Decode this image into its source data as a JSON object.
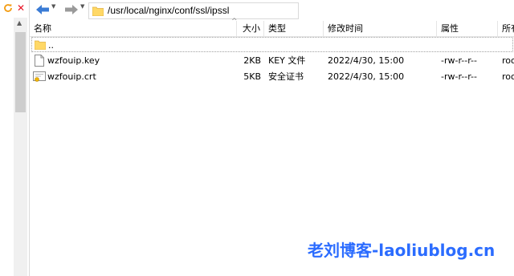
{
  "toolbar": {
    "address_path": "/usr/local/nginx/conf/ssl/ipssl"
  },
  "columns": {
    "name": "名称",
    "size": "大小",
    "type": "类型",
    "modified": "修改时间",
    "attributes": "属性",
    "owner": "所有"
  },
  "files": [
    {
      "name": "..",
      "size": "",
      "type": "",
      "modified": "",
      "attributes": "",
      "owner": "",
      "icon": "folder-icon"
    },
    {
      "name": "wzfouip.key",
      "size": "2KB",
      "type": "KEY 文件",
      "modified": "2022/4/30, 15:00",
      "attributes": "-rw-r--r--",
      "owner": "roo",
      "icon": "file-icon"
    },
    {
      "name": "wzfouip.crt",
      "size": "5KB",
      "type": "安全证书",
      "modified": "2022/4/30, 15:00",
      "attributes": "-rw-r--r--",
      "owner": "roo",
      "icon": "certificate-icon"
    }
  ],
  "watermark": "老刘博客-laoliublog.cn",
  "colors": {
    "accent": "#2b6cff",
    "folder": "#ffd866",
    "close": "#e81123"
  }
}
